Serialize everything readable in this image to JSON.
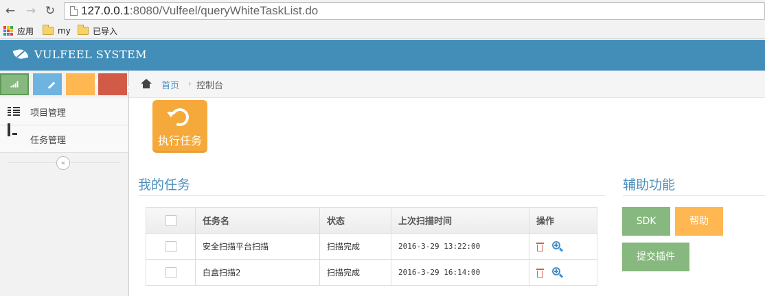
{
  "browser": {
    "url_host": "127.0.0.1",
    "url_rest": ":8080/Vulfeel/queryWhiteTaskList.do",
    "bookmarks": [
      {
        "label": "应用",
        "icon": "apps-grid-icon"
      },
      {
        "label": "my",
        "icon": "folder-icon"
      },
      {
        "label": "已导入",
        "icon": "folder-icon"
      }
    ]
  },
  "header": {
    "title": "VULFEEL SYSTEM",
    "logo_icon": "leaf-icon",
    "bar_color": "#438eb9"
  },
  "sidebar": {
    "shortcuts": [
      {
        "icon": "signal-icon",
        "color": "#87b87f"
      },
      {
        "icon": "pencil-icon",
        "color": "#6fb3e0"
      },
      {
        "icon": "users-icon",
        "color": "#ffb752"
      },
      {
        "icon": "cogs-icon",
        "color": "#d15b47"
      }
    ],
    "items": [
      {
        "label": "项目管理",
        "icon": "list-icon"
      },
      {
        "label": "任务管理",
        "icon": "desktop-icon"
      }
    ],
    "collapse_glyph": "«"
  },
  "breadcrumb": {
    "home": "首页",
    "separator": "›",
    "current": "控制台"
  },
  "actions": {
    "execute_label": "执行任务"
  },
  "tasks": {
    "title": "我的任务",
    "columns": [
      "任务名",
      "状态",
      "上次扫描时间",
      "操作"
    ],
    "rows": [
      {
        "name": "安全扫描平台扫描",
        "status": "扫描完成",
        "last_scan": "2016-3-29 13:22:00"
      },
      {
        "name": "白盒扫描2",
        "status": "扫描完成",
        "last_scan": "2016-3-29 16:14:00"
      }
    ]
  },
  "aux": {
    "title": "辅助功能",
    "sdk": "SDK",
    "help": "帮助",
    "submit_plugin": "提交插件"
  }
}
